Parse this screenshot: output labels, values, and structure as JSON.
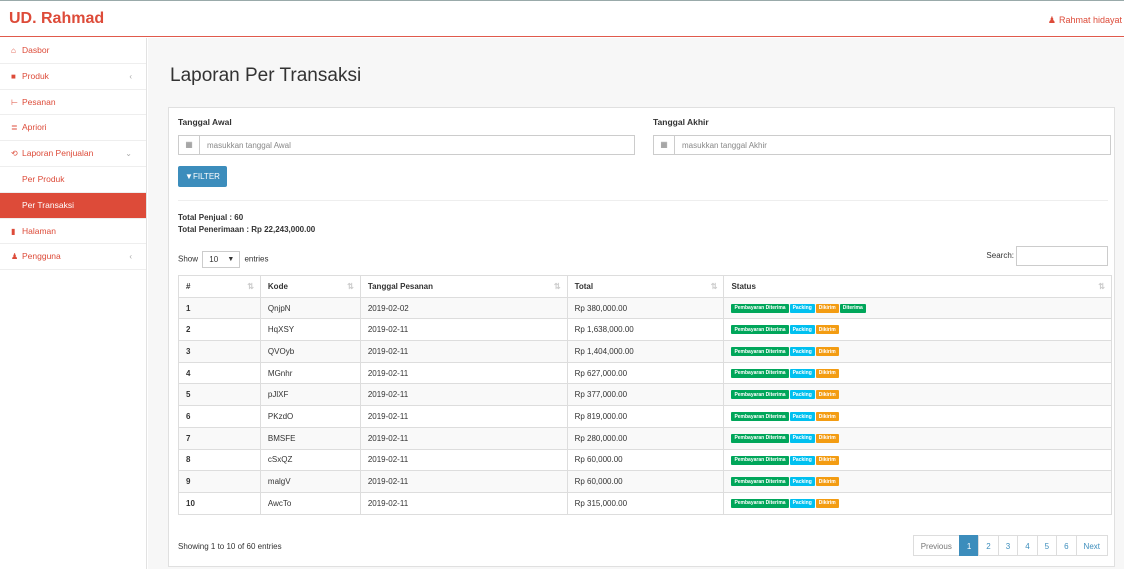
{
  "header": {
    "brand": "UD. Rahmad",
    "user": "Rahmat hidayat"
  },
  "sidebar": {
    "items": [
      {
        "label": "Dasbor",
        "icon": "dashboard-icon",
        "glyph": "⌂"
      },
      {
        "label": "Produk",
        "icon": "archive-icon",
        "glyph": "■",
        "chevron": "‹"
      },
      {
        "label": "Pesanan",
        "icon": "cart-icon",
        "glyph": "⊢"
      },
      {
        "label": "Apriori",
        "icon": "database-icon",
        "glyph": "≣"
      },
      {
        "label": "Laporan Penjualan",
        "icon": "history-icon",
        "glyph": "⟲",
        "chevron": "⌄"
      },
      {
        "label": "Per Produk",
        "sub": true
      },
      {
        "label": "Per Transaksi",
        "sub": true,
        "active": true
      },
      {
        "label": "Halaman",
        "icon": "file-icon",
        "glyph": "▮"
      },
      {
        "label": "Pengguna",
        "icon": "user-icon",
        "glyph": "♟",
        "chevron": "‹"
      }
    ]
  },
  "page": {
    "title": "Laporan Per Transaksi"
  },
  "filter": {
    "start_label": "Tanggal Awal",
    "start_placeholder": "masukkan tanggal Awal",
    "end_label": "Tanggal Akhir",
    "end_placeholder": "masukkan tanggal Akhir",
    "button_label": "FILTER"
  },
  "totals": {
    "penjual": "Total Penjual : 60",
    "penerimaan": "Total Penerimaan : Rp 22,243,000.00"
  },
  "table_controls": {
    "show": "Show",
    "entries_value": "10",
    "entries": "entries",
    "search": "Search:"
  },
  "table": {
    "columns": [
      "#",
      "Kode",
      "Tanggal Pesanan",
      "Total",
      "Status"
    ],
    "rows": [
      {
        "no": "1",
        "kode": "QnjpN",
        "tanggal": "2019-02-02",
        "total": "Rp 380,000.00",
        "status": [
          [
            "Pembayaran Diterima",
            "green"
          ],
          [
            "Packing",
            "blue"
          ],
          [
            "Dikirim",
            "orange"
          ],
          [
            "Diterima",
            "green"
          ]
        ]
      },
      {
        "no": "2",
        "kode": "HqXSY",
        "tanggal": "2019-02-11",
        "total": "Rp 1,638,000.00",
        "status": [
          [
            "Pembayaran Diterima",
            "green"
          ],
          [
            "Packing",
            "blue"
          ],
          [
            "Dikirim",
            "orange"
          ]
        ]
      },
      {
        "no": "3",
        "kode": "QVOyb",
        "tanggal": "2019-02-11",
        "total": "Rp 1,404,000.00",
        "status": [
          [
            "Pembayaran Diterima",
            "green"
          ],
          [
            "Packing",
            "blue"
          ],
          [
            "Dikirim",
            "orange"
          ]
        ]
      },
      {
        "no": "4",
        "kode": "MGnhr",
        "tanggal": "2019-02-11",
        "total": "Rp 627,000.00",
        "status": [
          [
            "Pembayaran Diterima",
            "green"
          ],
          [
            "Packing",
            "blue"
          ],
          [
            "Dikirim",
            "orange"
          ]
        ]
      },
      {
        "no": "5",
        "kode": "pJlXF",
        "tanggal": "2019-02-11",
        "total": "Rp 377,000.00",
        "status": [
          [
            "Pembayaran Diterima",
            "green"
          ],
          [
            "Packing",
            "blue"
          ],
          [
            "Dikirim",
            "orange"
          ]
        ]
      },
      {
        "no": "6",
        "kode": "PKzdO",
        "tanggal": "2019-02-11",
        "total": "Rp 819,000.00",
        "status": [
          [
            "Pembayaran Diterima",
            "green"
          ],
          [
            "Packing",
            "blue"
          ],
          [
            "Dikirim",
            "orange"
          ]
        ]
      },
      {
        "no": "7",
        "kode": "BMSFE",
        "tanggal": "2019-02-11",
        "total": "Rp 280,000.00",
        "status": [
          [
            "Pembayaran Diterima",
            "green"
          ],
          [
            "Packing",
            "blue"
          ],
          [
            "Dikirim",
            "orange"
          ]
        ]
      },
      {
        "no": "8",
        "kode": "cSxQZ",
        "tanggal": "2019-02-11",
        "total": "Rp 60,000.00",
        "status": [
          [
            "Pembayaran Diterima",
            "green"
          ],
          [
            "Packing",
            "blue"
          ],
          [
            "Dikirim",
            "orange"
          ]
        ]
      },
      {
        "no": "9",
        "kode": "malgV",
        "tanggal": "2019-02-11",
        "total": "Rp 60,000.00",
        "status": [
          [
            "Pembayaran Diterima",
            "green"
          ],
          [
            "Packing",
            "blue"
          ],
          [
            "Dikirim",
            "orange"
          ]
        ]
      },
      {
        "no": "10",
        "kode": "AwcTo",
        "tanggal": "2019-02-11",
        "total": "Rp 315,000.00",
        "status": [
          [
            "Pembayaran Diterima",
            "green"
          ],
          [
            "Packing",
            "blue"
          ],
          [
            "Dikirim",
            "orange"
          ]
        ]
      }
    ]
  },
  "footer": {
    "info": "Showing 1 to 10 of 60 entries",
    "pagination": [
      "Previous",
      "1",
      "2",
      "3",
      "4",
      "5",
      "6",
      "Next"
    ],
    "current_page": "1"
  },
  "colors": {
    "accent": "#dd4b39",
    "primary": "#3c8dbc",
    "green": "#00a65a",
    "blue": "#00c0ef",
    "orange": "#f39c12"
  }
}
